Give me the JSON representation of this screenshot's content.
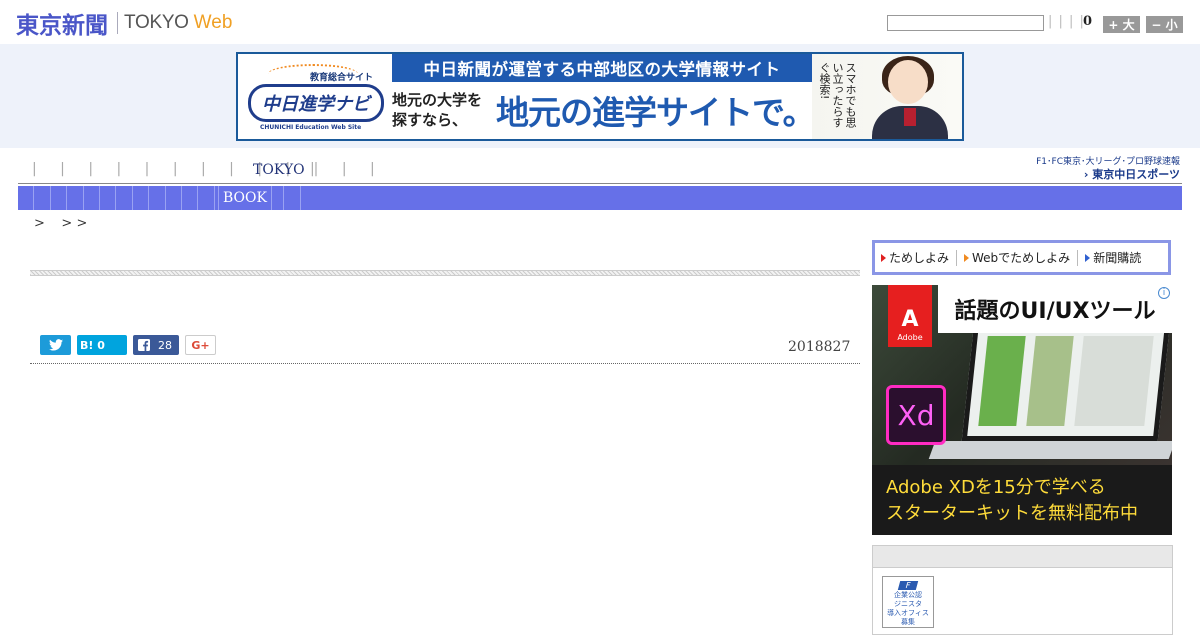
{
  "header": {
    "logo_jp": "東京新聞",
    "logo_en": "TOKYO",
    "logo_web": "Web",
    "search_placeholder": "",
    "pipes": "| | | |",
    "counter": "0",
    "font_larger": "+ 大",
    "font_smaller": "− 小"
  },
  "banner": {
    "category": "教育総合サイト",
    "brand": "中日進学ナビ",
    "brand_sub": "CHUNICHI Education Web Site",
    "headline": "中日新聞が運営する中部地区の大学情報サイト",
    "sub_left": "地元の大学を\n探すなら、",
    "sub_big": "地元の進学サイトで。",
    "girl_text": "スマホでも思い立ったらすぐ検索!"
  },
  "nav": {
    "pipes": "| | | | | | | | | | | | |",
    "tokyo": "TOKYO",
    "tokyo_sep": "|",
    "sports_top": "F1･FC東京･大リーグ･プロ野球速報",
    "sports_bottom": "› 東京中日スポーツ"
  },
  "subnav": {
    "book": "BOOK"
  },
  "breadcrumb": ">    > >",
  "article": {
    "date": "2018827"
  },
  "share": {
    "hatena": "B! 0",
    "facebook_count": "28",
    "gplus": "G+"
  },
  "subscribe": {
    "items": [
      {
        "label": "ためしよみ"
      },
      {
        "label": "Webでためしよみ"
      },
      {
        "label": "新聞購読"
      }
    ]
  },
  "ad": {
    "headline": "話題のUI/UXツール",
    "adobe": "Adobe",
    "xd": "Xd",
    "info": "i",
    "line1": "Adobe XDを15分で学べる",
    "line2": "スターターキットを無料配布中"
  },
  "badge": {
    "icon": "F",
    "text": "企業公認\nジニスタ\n導入オフィス\n募集"
  },
  "colors": {
    "brand_blue": "#4a56c8",
    "web_orange": "#f0a024",
    "nav_bar": "#6670e8"
  }
}
